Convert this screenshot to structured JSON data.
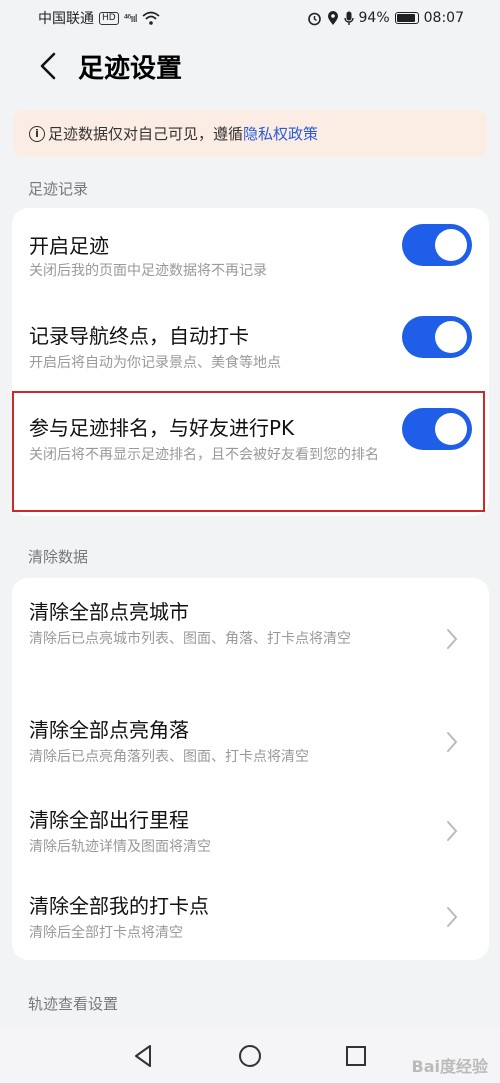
{
  "status_bar": {
    "carrier": "中国联通",
    "network_badge": "HD",
    "signal": "⁴⁶ııl",
    "battery_percent": "94%",
    "time": "08:07"
  },
  "header": {
    "title": "足迹设置"
  },
  "notice": {
    "text": "足迹数据仅对自己可见，遵循 ",
    "link": "隐私权政策"
  },
  "sections": {
    "footprint_record": "足迹记录",
    "clear_data": "清除数据",
    "track_view": "轨迹查看设置"
  },
  "toggles": [
    {
      "title": "开启足迹",
      "subtitle": "关闭后我的页面中足迹数据将不再记录",
      "on": true
    },
    {
      "title": "记录导航终点，自动打卡",
      "subtitle": "开启后将自动为你记录景点、美食等地点",
      "on": true
    },
    {
      "title": "参与足迹排名，与好友进行PK",
      "subtitle": "关闭后将不再显示足迹排名，且不会被好友看到您的排名",
      "on": true
    }
  ],
  "clear_items": [
    {
      "title": "清除全部点亮城市",
      "subtitle": "清除后已点亮城市列表、图面、角落、打卡点将清空"
    },
    {
      "title": "清除全部点亮角落",
      "subtitle": "清除后已点亮角落列表、图面、打卡点将清空"
    },
    {
      "title": "清除全部出行里程",
      "subtitle": "清除后轨迹详情及图面将清空"
    },
    {
      "title": "清除全部我的打卡点",
      "subtitle": "清除后全部打卡点将清空"
    }
  ],
  "watermark": "Bai度经验",
  "colors": {
    "accent": "#1f5ee8",
    "highlight_border": "#cc2a2a",
    "notice_bg": "#fbece4",
    "link": "#2a5cd6"
  }
}
